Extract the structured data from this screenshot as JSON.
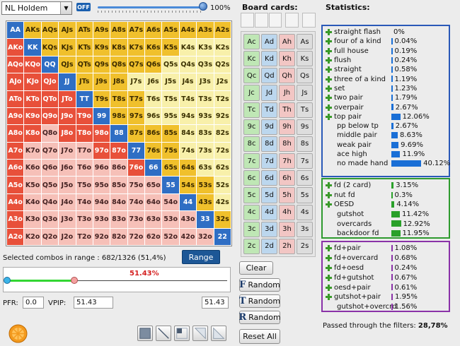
{
  "top": {
    "game": "NL Holdem",
    "toggle": "OFF",
    "slider_value_pct": 100,
    "slider_label": "100%"
  },
  "colors": {
    "y": "#f0c02c",
    "ly": "#f8f0aa",
    "b": "#2f6ec4",
    "r": "#e8503a",
    "p": "#f6c0b8",
    "g": "#eaeaea",
    "made_border": "#2a59b8",
    "draw_border": "#2e9a2e",
    "combo_border": "#8a32a8"
  },
  "grid_rows": [
    [
      [
        "AA",
        "b"
      ],
      [
        "AKs",
        "y"
      ],
      [
        "AQs",
        "y"
      ],
      [
        "AJs",
        "y"
      ],
      [
        "ATs",
        "y"
      ],
      [
        "A9s",
        "y"
      ],
      [
        "A8s",
        "y"
      ],
      [
        "A7s",
        "y"
      ],
      [
        "A6s",
        "y"
      ],
      [
        "A5s",
        "y"
      ],
      [
        "A4s",
        "y"
      ],
      [
        "A3s",
        "y"
      ],
      [
        "A2s",
        "y"
      ]
    ],
    [
      [
        "AKo",
        "r"
      ],
      [
        "KK",
        "b"
      ],
      [
        "KQs",
        "y"
      ],
      [
        "KJs",
        "y"
      ],
      [
        "KTs",
        "y"
      ],
      [
        "K9s",
        "y"
      ],
      [
        "K8s",
        "y"
      ],
      [
        "K7s",
        "y"
      ],
      [
        "K6s",
        "y"
      ],
      [
        "K5s",
        "y"
      ],
      [
        "K4s",
        "ly"
      ],
      [
        "K3s",
        "ly"
      ],
      [
        "K2s",
        "ly"
      ]
    ],
    [
      [
        "AQo",
        "r"
      ],
      [
        "KQo",
        "r"
      ],
      [
        "QQ",
        "b"
      ],
      [
        "QJs",
        "y"
      ],
      [
        "QTs",
        "y"
      ],
      [
        "Q9s",
        "y"
      ],
      [
        "Q8s",
        "y"
      ],
      [
        "Q7s",
        "y"
      ],
      [
        "Q6s",
        "y"
      ],
      [
        "Q5s",
        "ly"
      ],
      [
        "Q4s",
        "ly"
      ],
      [
        "Q3s",
        "ly"
      ],
      [
        "Q2s",
        "ly"
      ]
    ],
    [
      [
        "AJo",
        "r"
      ],
      [
        "KJo",
        "r"
      ],
      [
        "QJo",
        "r"
      ],
      [
        "JJ",
        "b"
      ],
      [
        "JTs",
        "y"
      ],
      [
        "J9s",
        "y"
      ],
      [
        "J8s",
        "y"
      ],
      [
        "J7s",
        "ly"
      ],
      [
        "J6s",
        "ly"
      ],
      [
        "J5s",
        "ly"
      ],
      [
        "J4s",
        "ly"
      ],
      [
        "J3s",
        "ly"
      ],
      [
        "J2s",
        "ly"
      ]
    ],
    [
      [
        "ATo",
        "r"
      ],
      [
        "KTo",
        "r"
      ],
      [
        "QTo",
        "r"
      ],
      [
        "JTo",
        "r"
      ],
      [
        "TT",
        "b"
      ],
      [
        "T9s",
        "y"
      ],
      [
        "T8s",
        "y"
      ],
      [
        "T7s",
        "y"
      ],
      [
        "T6s",
        "ly"
      ],
      [
        "T5s",
        "ly"
      ],
      [
        "T4s",
        "ly"
      ],
      [
        "T3s",
        "ly"
      ],
      [
        "T2s",
        "ly"
      ]
    ],
    [
      [
        "A9o",
        "r"
      ],
      [
        "K9o",
        "r"
      ],
      [
        "Q9o",
        "r"
      ],
      [
        "J9o",
        "r"
      ],
      [
        "T9o",
        "r"
      ],
      [
        "99",
        "b"
      ],
      [
        "98s",
        "y"
      ],
      [
        "97s",
        "y"
      ],
      [
        "96s",
        "ly"
      ],
      [
        "95s",
        "ly"
      ],
      [
        "94s",
        "ly"
      ],
      [
        "93s",
        "ly"
      ],
      [
        "92s",
        "ly"
      ]
    ],
    [
      [
        "A8o",
        "r"
      ],
      [
        "K8o",
        "r"
      ],
      [
        "Q8o",
        "p"
      ],
      [
        "J8o",
        "r"
      ],
      [
        "T8o",
        "r"
      ],
      [
        "98o",
        "r"
      ],
      [
        "88",
        "b"
      ],
      [
        "87s",
        "y"
      ],
      [
        "86s",
        "y"
      ],
      [
        "85s",
        "y"
      ],
      [
        "84s",
        "ly"
      ],
      [
        "83s",
        "ly"
      ],
      [
        "82s",
        "ly"
      ]
    ],
    [
      [
        "A7o",
        "r"
      ],
      [
        "K7o",
        "p"
      ],
      [
        "Q7o",
        "p"
      ],
      [
        "J7o",
        "p"
      ],
      [
        "T7o",
        "p"
      ],
      [
        "97o",
        "r"
      ],
      [
        "87o",
        "r"
      ],
      [
        "77",
        "b"
      ],
      [
        "76s",
        "y"
      ],
      [
        "75s",
        "y"
      ],
      [
        "74s",
        "ly"
      ],
      [
        "73s",
        "ly"
      ],
      [
        "72s",
        "ly"
      ]
    ],
    [
      [
        "A6o",
        "r"
      ],
      [
        "K6o",
        "p"
      ],
      [
        "Q6o",
        "p"
      ],
      [
        "J6o",
        "p"
      ],
      [
        "T6o",
        "p"
      ],
      [
        "96o",
        "p"
      ],
      [
        "86o",
        "p"
      ],
      [
        "76o",
        "r"
      ],
      [
        "66",
        "b"
      ],
      [
        "65s",
        "y"
      ],
      [
        "64s",
        "y"
      ],
      [
        "63s",
        "ly"
      ],
      [
        "62s",
        "ly"
      ]
    ],
    [
      [
        "A5o",
        "r"
      ],
      [
        "K5o",
        "p"
      ],
      [
        "Q5o",
        "p"
      ],
      [
        "J5o",
        "p"
      ],
      [
        "T5o",
        "p"
      ],
      [
        "95o",
        "p"
      ],
      [
        "85o",
        "p"
      ],
      [
        "75o",
        "p"
      ],
      [
        "65o",
        "p"
      ],
      [
        "55",
        "b"
      ],
      [
        "54s",
        "y"
      ],
      [
        "53s",
        "y"
      ],
      [
        "52s",
        "ly"
      ]
    ],
    [
      [
        "A4o",
        "r"
      ],
      [
        "K4o",
        "p"
      ],
      [
        "Q4o",
        "p"
      ],
      [
        "J4o",
        "p"
      ],
      [
        "T4o",
        "p"
      ],
      [
        "94o",
        "p"
      ],
      [
        "84o",
        "p"
      ],
      [
        "74o",
        "p"
      ],
      [
        "64o",
        "p"
      ],
      [
        "54o",
        "p"
      ],
      [
        "44",
        "b"
      ],
      [
        "43s",
        "y"
      ],
      [
        "42s",
        "ly"
      ]
    ],
    [
      [
        "A3o",
        "r"
      ],
      [
        "K3o",
        "p"
      ],
      [
        "Q3o",
        "p"
      ],
      [
        "J3o",
        "p"
      ],
      [
        "T3o",
        "p"
      ],
      [
        "93o",
        "p"
      ],
      [
        "83o",
        "p"
      ],
      [
        "73o",
        "p"
      ],
      [
        "63o",
        "p"
      ],
      [
        "53o",
        "p"
      ],
      [
        "43o",
        "p"
      ],
      [
        "33",
        "b"
      ],
      [
        "32s",
        "y"
      ]
    ],
    [
      [
        "A2o",
        "r"
      ],
      [
        "K2o",
        "p"
      ],
      [
        "Q2o",
        "p"
      ],
      [
        "J2o",
        "p"
      ],
      [
        "T2o",
        "p"
      ],
      [
        "92o",
        "p"
      ],
      [
        "82o",
        "p"
      ],
      [
        "72o",
        "p"
      ],
      [
        "62o",
        "p"
      ],
      [
        "52o",
        "p"
      ],
      [
        "42o",
        "p"
      ],
      [
        "32o",
        "p"
      ],
      [
        "22",
        "b"
      ]
    ]
  ],
  "board": {
    "title": "Board cards:",
    "ranks": [
      "A",
      "K",
      "Q",
      "J",
      "T",
      "9",
      "8",
      "7",
      "6",
      "5",
      "4",
      "3",
      "2"
    ],
    "suits": [
      "c",
      "d",
      "h",
      "s"
    ]
  },
  "buttons": {
    "clear": "Clear",
    "random": "Random",
    "random_letters": [
      "F",
      "T",
      "R"
    ],
    "reset": "Reset All",
    "range": "Range"
  },
  "stats": {
    "title": "Statistics:",
    "made": [
      {
        "label": "straight flash",
        "pct": "0%",
        "v": 0,
        "plus": true
      },
      {
        "label": "four of a kind",
        "pct": "0.04%",
        "v": 0.04,
        "plus": true
      },
      {
        "label": "full house",
        "pct": "0.19%",
        "v": 0.19,
        "plus": true
      },
      {
        "label": "flush",
        "pct": "0.24%",
        "v": 0.24,
        "plus": true
      },
      {
        "label": "straight",
        "pct": "0.58%",
        "v": 0.58,
        "plus": true
      },
      {
        "label": "three of a kind",
        "pct": "1.19%",
        "v": 1.19,
        "plus": true
      },
      {
        "label": "set",
        "pct": "1.23%",
        "v": 1.23,
        "plus": true
      },
      {
        "label": "two pair",
        "pct": "1.79%",
        "v": 1.79,
        "plus": true
      },
      {
        "label": "overpair",
        "pct": "2.67%",
        "v": 2.67,
        "plus": true
      },
      {
        "label": "top pair",
        "pct": "12.06%",
        "v": 12.06,
        "plus": true
      },
      {
        "label": "pp below tp",
        "pct": "2.67%",
        "v": 2.67,
        "plus": false
      },
      {
        "label": "middle pair",
        "pct": "8.63%",
        "v": 8.63,
        "plus": false
      },
      {
        "label": "weak pair",
        "pct": "9.69%",
        "v": 9.69,
        "plus": false
      },
      {
        "label": "ace high",
        "pct": "11.9%",
        "v": 11.9,
        "plus": false
      },
      {
        "label": "no made hand",
        "pct": "40.12%",
        "v": 40.12,
        "plus": false
      }
    ],
    "draws": [
      {
        "label": "fd (2 card)",
        "pct": "3.15%",
        "v": 3.15,
        "plus": true
      },
      {
        "label": "nut fd",
        "pct": "0.3%",
        "v": 0.3,
        "plus": true
      },
      {
        "label": "OESD",
        "pct": "4.14%",
        "v": 4.14,
        "plus": true
      },
      {
        "label": "gutshot",
        "pct": "11.42%",
        "v": 11.42,
        "plus": false
      },
      {
        "label": "overcards",
        "pct": "12.92%",
        "v": 12.92,
        "plus": false
      },
      {
        "label": "backdoor fd",
        "pct": "11.95%",
        "v": 11.95,
        "plus": false
      }
    ],
    "combos": [
      {
        "label": "fd+pair",
        "pct": "1.08%",
        "v": 1.08,
        "plus": true
      },
      {
        "label": "fd+overcard",
        "pct": "0.68%",
        "v": 0.68,
        "plus": true
      },
      {
        "label": "fd+oesd",
        "pct": "0.24%",
        "v": 0.24,
        "plus": true
      },
      {
        "label": "fd+gutshot",
        "pct": "0.67%",
        "v": 0.67,
        "plus": true
      },
      {
        "label": "oesd+pair",
        "pct": "0.61%",
        "v": 0.61,
        "plus": true
      },
      {
        "label": "gutshot+pair",
        "pct": "1.95%",
        "v": 1.95,
        "plus": true
      },
      {
        "label": "gutshot+overcrd",
        "pct": "1.56%",
        "v": 1.56,
        "plus": false
      }
    ],
    "passed_label": "Passed through the filters:",
    "passed_value": "28,78%"
  },
  "range_area": {
    "selected_text": "Selected combos in range : 682/1326 (51,4%)",
    "slider_label": "51.43%",
    "slider_value": 51.43,
    "pfr_label": "PFR:",
    "pfr_value": "0.0",
    "vpip_label": "VPIP:",
    "vpip_value": "51.43",
    "vpip_value2": "51.43"
  }
}
